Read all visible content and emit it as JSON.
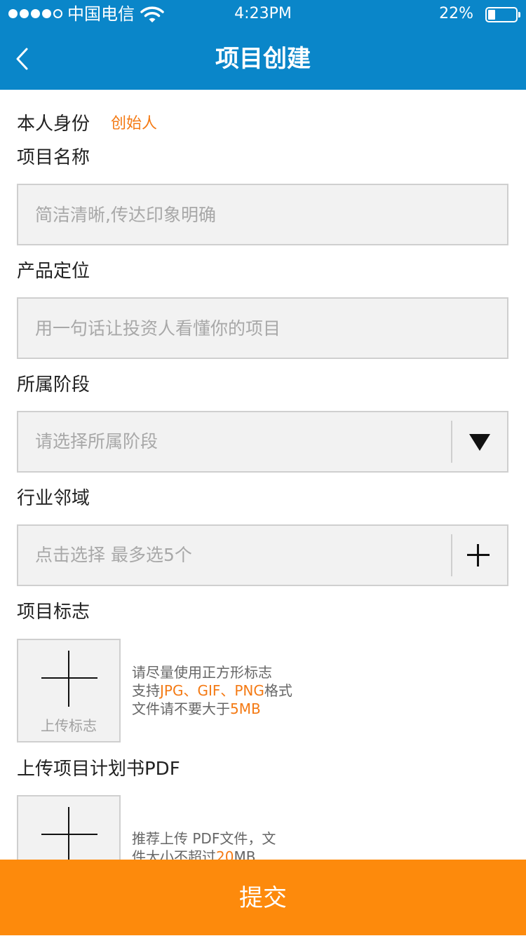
{
  "status": {
    "carrier": "中国电信",
    "time": "4:23PM",
    "battery": "22%",
    "battery_level": 0.22
  },
  "nav": {
    "title": "项目创建",
    "back_icon": "chevron-left-icon"
  },
  "form": {
    "identity_label": "本人身份",
    "identity_value": "创始人",
    "name_label": "项目名称",
    "name_placeholder": "简洁清晰,传达印象明确",
    "positioning_label": "产品定位",
    "positioning_placeholder": "用一句话让投资人看懂你的项目",
    "stage_label": "所属阶段",
    "stage_placeholder": "请选择所属阶段",
    "industry_label": "行业邻域",
    "industry_placeholder": "点击选择 最多选5个",
    "logo_label": "项目标志",
    "logo_upload_caption": "上传标志",
    "logo_hint_1": "请尽量使用正方形标志",
    "logo_hint_2_prefix": "支持",
    "logo_hint_2_formats": "JPG、GIF、PNG",
    "logo_hint_2_suffix": "格式",
    "logo_hint_3_prefix": "文件请不要大于",
    "logo_hint_3_size": "5MB",
    "pdf_label": "上传项目计划书PDF",
    "pdf_hint_1": "推荐上传 PDF文件，文",
    "pdf_hint_2_prefix": "件大小不超过",
    "pdf_hint_2_size": "20",
    "pdf_hint_2_suffix": "MB"
  },
  "submit_label": "提交",
  "colors": {
    "header": "#0a86c9",
    "accent": "#f47a14",
    "submit": "#fd8a0c"
  }
}
